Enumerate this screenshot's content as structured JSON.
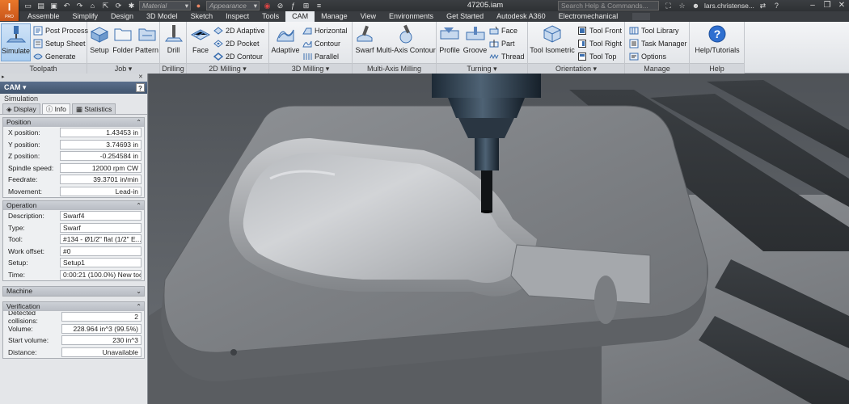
{
  "app": {
    "logo_letter": "I",
    "logo_sub": "PRO",
    "document_title": "47205.iam",
    "search_placeholder": "Search Help & Commands...",
    "user_name": "lars.christense...",
    "material_combo": "Material",
    "appearance_combo": "Appearance"
  },
  "tabs": [
    "Assemble",
    "Simplify",
    "Design",
    "3D Model",
    "Sketch",
    "Inspect",
    "Tools",
    "CAM",
    "Manage",
    "View",
    "Environments",
    "Get Started",
    "Autodesk A360",
    "Electromechanical"
  ],
  "active_tab": "CAM",
  "ribbon": {
    "toolpath": {
      "title": "Toolpath",
      "simulate": "Simulate",
      "post_process": "Post Process",
      "setup_sheet": "Setup Sheet",
      "generate": "Generate"
    },
    "job": {
      "title": "Job ▾",
      "setup": "Setup",
      "folder": "Folder",
      "pattern": "Pattern"
    },
    "drilling": {
      "title": "Drilling",
      "drill": "Drill"
    },
    "milling2d": {
      "title": "2D Milling ▾",
      "face": "Face",
      "adaptive2d": "2D Adaptive",
      "pocket2d": "2D Pocket",
      "contour2d": "2D Contour"
    },
    "milling3d": {
      "title": "3D Milling ▾",
      "adaptive": "Adaptive",
      "horizontal": "Horizontal",
      "contour": "Contour",
      "parallel": "Parallel"
    },
    "multiaxis": {
      "title": "Multi-Axis Milling",
      "swarf": "Swarf",
      "multi_axis_contour": "Multi-Axis Contour"
    },
    "turning": {
      "title": "Turning ▾",
      "profile": "Profile",
      "groove": "Groove",
      "face": "Face",
      "part": "Part",
      "thread": "Thread"
    },
    "orientation": {
      "title": "Orientation ▾",
      "tool_isometric": "Tool Isometric",
      "tool_front": "Tool Front",
      "tool_right": "Tool Right",
      "tool_top": "Tool Top"
    },
    "manage": {
      "title": "Manage",
      "tool_library": "Tool Library",
      "task_manager": "Task Manager",
      "options": "Options"
    },
    "help": {
      "title": "Help",
      "help_tutorials": "Help/Tutorials"
    }
  },
  "browser": {
    "header": "CAM ▾",
    "subtitle": "Simulation",
    "tabs": [
      "Display",
      "Info",
      "Statistics"
    ],
    "active_tab": "Info",
    "position": {
      "title": "Position",
      "rows": [
        {
          "label": "X position:",
          "value": "1.43453 in"
        },
        {
          "label": "Y position:",
          "value": "3.74693 in"
        },
        {
          "label": "Z position:",
          "value": "-0.254584 in"
        },
        {
          "label": "Spindle speed:",
          "value": "12000 rpm CW"
        },
        {
          "label": "Feedrate:",
          "value": "39.3701 in/min"
        },
        {
          "label": "Movement:",
          "value": "Lead-in"
        }
      ]
    },
    "operation": {
      "title": "Operation",
      "rows": [
        {
          "label": "Description:",
          "value": "Swarf4"
        },
        {
          "label": "Type:",
          "value": "Swarf"
        },
        {
          "label": "Tool:",
          "value": "#134 - Ø1/2\" flat (1/2\" E..."
        },
        {
          "label": "Work offset:",
          "value": "#0"
        },
        {
          "label": "Setup:",
          "value": "Setup1"
        },
        {
          "label": "Time:",
          "value": "0:00:21 (100.0%) New tool"
        }
      ]
    },
    "machine": {
      "title": "Machine"
    },
    "verification": {
      "title": "Verification",
      "rows": [
        {
          "label": "Detected collisions:",
          "value": "2"
        },
        {
          "label": "Volume:",
          "value": "228.964 in^3 (99.5%)"
        },
        {
          "label": "Start volume:",
          "value": "230 in^3"
        },
        {
          "label": "Distance:",
          "value": "Unavailable"
        }
      ]
    }
  }
}
